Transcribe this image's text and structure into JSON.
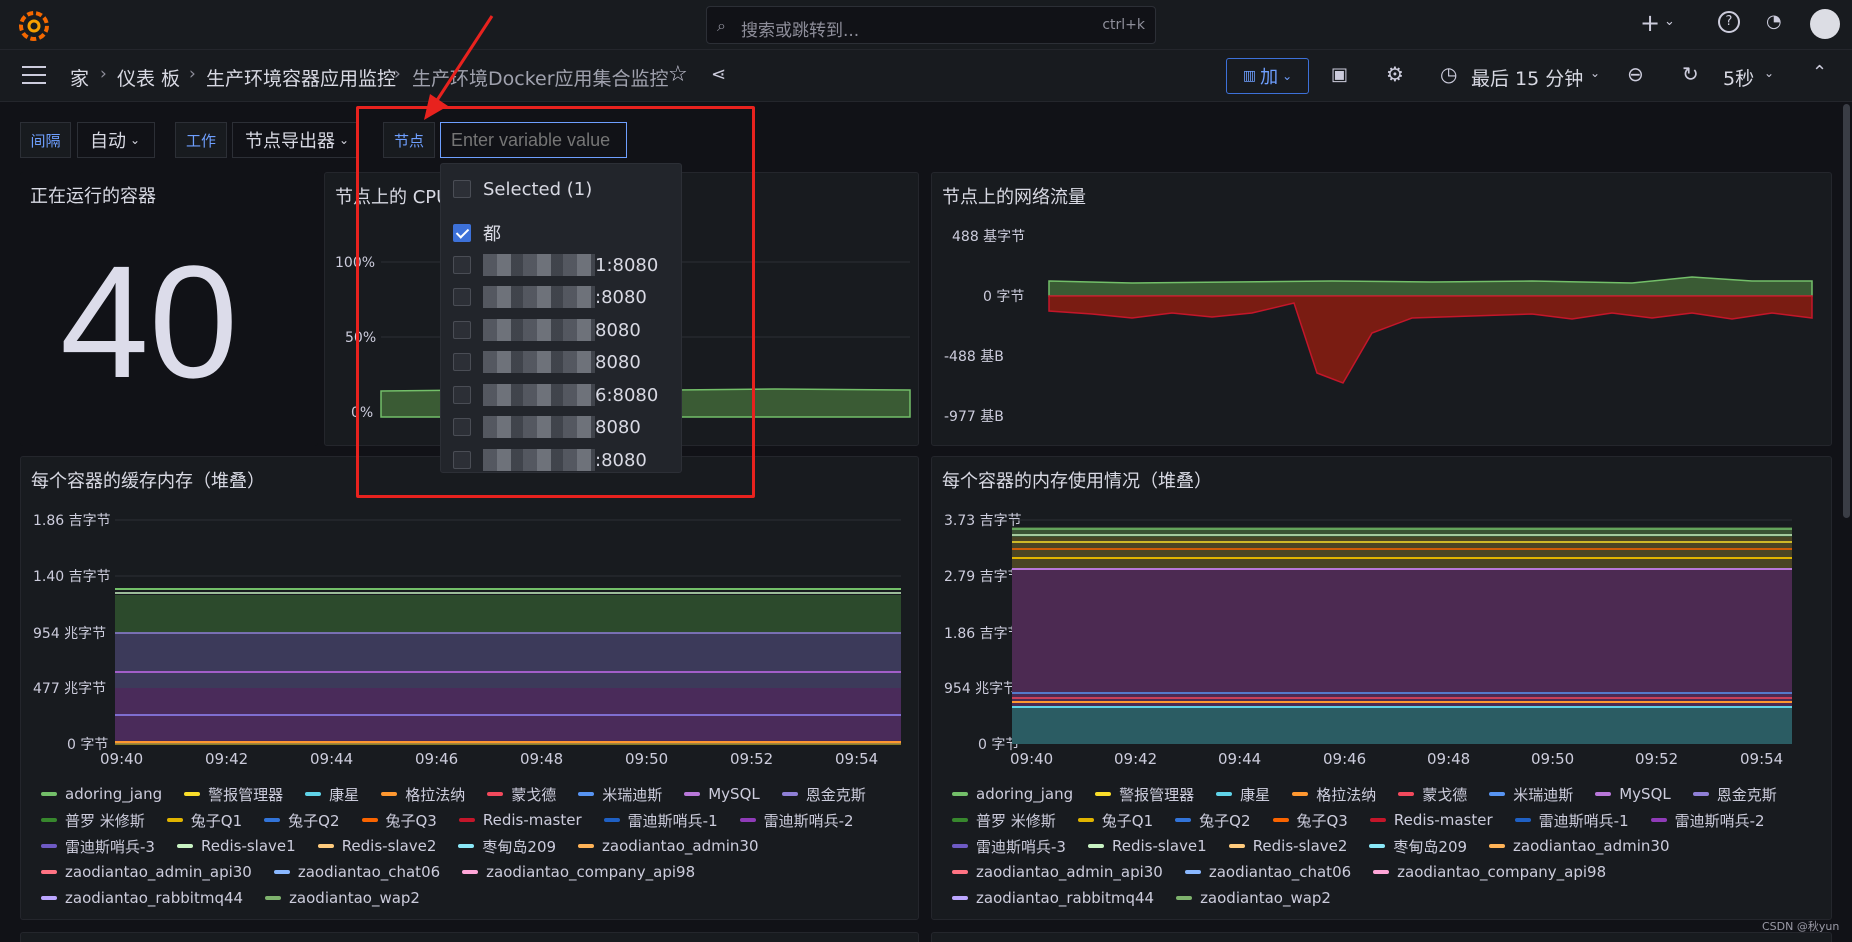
{
  "topbar": {
    "search_placeholder": "搜索或跳转到...",
    "search_shortcut": "ctrl+k"
  },
  "nav": {
    "breadcrumbs": [
      "家",
      "仪表 板",
      "生产环境容器应用监控",
      "生产环境Docker应用集合监控"
    ],
    "add_label": "加",
    "time_range": "最后 15 分钟",
    "refresh": "5秒"
  },
  "variables": {
    "interval_label": "间隔",
    "interval_value": "自动",
    "job_label": "工作",
    "job_value": "节点导出器",
    "node_label": "节点",
    "node_placeholder": "Enter variable value"
  },
  "dropdown": {
    "selected_label": "Selected (1)",
    "all_label": "都",
    "options": [
      ":8080",
      ":8080",
      ":8080",
      ":8080",
      ":8080",
      ":8080",
      ":8080"
    ],
    "option_suffixes": [
      "1:8080",
      ":8080",
      "8080",
      "8080",
      "6:8080",
      "8080",
      ":8080"
    ]
  },
  "panels": {
    "running": {
      "title": "正在运行的容器",
      "value": "40"
    },
    "cpu": {
      "title": "节点上的 CPU",
      "ticks": [
        "100%",
        "50%",
        "0%"
      ]
    },
    "network": {
      "title": "节点上的网络流量",
      "ticks": [
        "488 基字节",
        "0 字节",
        "-488 基B",
        "-977 基B"
      ]
    },
    "cache": {
      "title": "每个容器的缓存内存（堆叠）",
      "ticks": [
        "1.86 吉字节",
        "1.40 吉字节",
        "954 兆字节",
        "477 兆字节",
        "0 字节"
      ]
    },
    "memory": {
      "title": "每个容器的内存使用情况（堆叠）",
      "ticks": [
        "3.73 吉字节",
        "2.79 吉字节",
        "1.86 吉字节",
        "954 兆字节",
        "0 字节"
      ]
    }
  },
  "x_ticks": [
    "09:40",
    "09:42",
    "09:44",
    "09:46",
    "09:48",
    "09:50",
    "09:52",
    "09:54"
  ],
  "legend": [
    {
      "name": "adoring_jang",
      "color": "#73bf69"
    },
    {
      "name": "警报管理器",
      "color": "#fade2a"
    },
    {
      "name": "康星",
      "color": "#5fd3e8"
    },
    {
      "name": "格拉法纳",
      "color": "#ff9830"
    },
    {
      "name": "蒙戈德",
      "color": "#f2495c"
    },
    {
      "name": "米瑞迪斯",
      "color": "#5794f2"
    },
    {
      "name": "MySQL",
      "color": "#b877d9"
    },
    {
      "name": "恩金克斯",
      "color": "#8f7fd6"
    },
    {
      "name": "普罗 米修斯",
      "color": "#37872d"
    },
    {
      "name": "兔子Q1",
      "color": "#e0b400"
    },
    {
      "name": "兔子Q2",
      "color": "#3274d9"
    },
    {
      "name": "兔子Q3",
      "color": "#fa6400"
    },
    {
      "name": "Redis-master",
      "color": "#c4162a"
    },
    {
      "name": "雷迪斯哨兵-1",
      "color": "#1f60c4"
    },
    {
      "name": "雷迪斯哨兵-2",
      "color": "#8f3bb8"
    },
    {
      "name": "雷迪斯哨兵-3",
      "color": "#6e5ac4"
    },
    {
      "name": "Redis-slave1",
      "color": "#c8f2c2"
    },
    {
      "name": "Redis-slave2",
      "color": "#ffcb7d"
    },
    {
      "name": "枣甸岛209",
      "color": "#8ae8f7"
    },
    {
      "name": "zaodiantao_admin30",
      "color": "#ffb357"
    },
    {
      "name": "zaodiantao_admin_api30",
      "color": "#ff7383"
    },
    {
      "name": "zaodiantao_chat06",
      "color": "#8ab8ff"
    },
    {
      "name": "zaodiantao_company_api98",
      "color": "#ffa6d8"
    },
    {
      "name": "zaodiantao_rabbitmq44",
      "color": "#bba6ff"
    },
    {
      "name": "zaodiantao_wap2",
      "color": "#7eb26d"
    }
  ],
  "watermark": "CSDN @秋yun"
}
